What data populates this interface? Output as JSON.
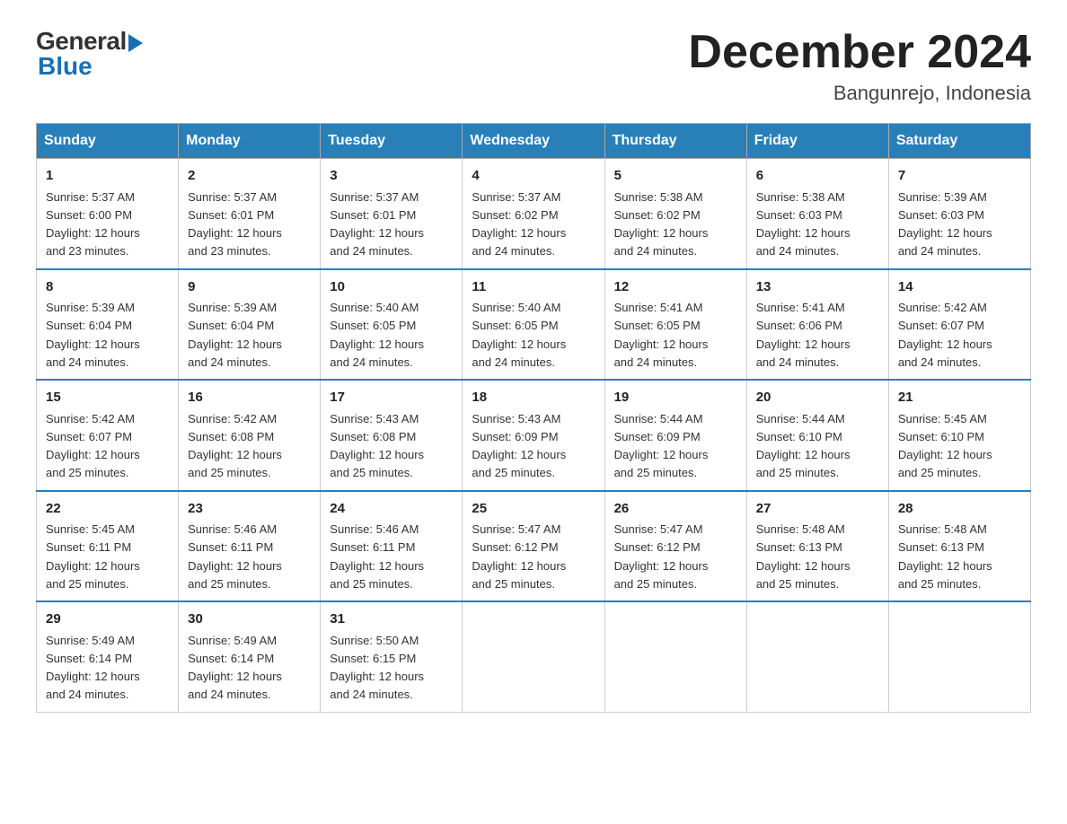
{
  "header": {
    "logo_general": "General",
    "logo_blue": "Blue",
    "month_title": "December 2024",
    "location": "Bangunrejo, Indonesia"
  },
  "days_of_week": [
    "Sunday",
    "Monday",
    "Tuesday",
    "Wednesday",
    "Thursday",
    "Friday",
    "Saturday"
  ],
  "weeks": [
    [
      {
        "day": "1",
        "sunrise": "5:37 AM",
        "sunset": "6:00 PM",
        "daylight": "12 hours and 23 minutes."
      },
      {
        "day": "2",
        "sunrise": "5:37 AM",
        "sunset": "6:01 PM",
        "daylight": "12 hours and 23 minutes."
      },
      {
        "day": "3",
        "sunrise": "5:37 AM",
        "sunset": "6:01 PM",
        "daylight": "12 hours and 24 minutes."
      },
      {
        "day": "4",
        "sunrise": "5:37 AM",
        "sunset": "6:02 PM",
        "daylight": "12 hours and 24 minutes."
      },
      {
        "day": "5",
        "sunrise": "5:38 AM",
        "sunset": "6:02 PM",
        "daylight": "12 hours and 24 minutes."
      },
      {
        "day": "6",
        "sunrise": "5:38 AM",
        "sunset": "6:03 PM",
        "daylight": "12 hours and 24 minutes."
      },
      {
        "day": "7",
        "sunrise": "5:39 AM",
        "sunset": "6:03 PM",
        "daylight": "12 hours and 24 minutes."
      }
    ],
    [
      {
        "day": "8",
        "sunrise": "5:39 AM",
        "sunset": "6:04 PM",
        "daylight": "12 hours and 24 minutes."
      },
      {
        "day": "9",
        "sunrise": "5:39 AM",
        "sunset": "6:04 PM",
        "daylight": "12 hours and 24 minutes."
      },
      {
        "day": "10",
        "sunrise": "5:40 AM",
        "sunset": "6:05 PM",
        "daylight": "12 hours and 24 minutes."
      },
      {
        "day": "11",
        "sunrise": "5:40 AM",
        "sunset": "6:05 PM",
        "daylight": "12 hours and 24 minutes."
      },
      {
        "day": "12",
        "sunrise": "5:41 AM",
        "sunset": "6:05 PM",
        "daylight": "12 hours and 24 minutes."
      },
      {
        "day": "13",
        "sunrise": "5:41 AM",
        "sunset": "6:06 PM",
        "daylight": "12 hours and 24 minutes."
      },
      {
        "day": "14",
        "sunrise": "5:42 AM",
        "sunset": "6:07 PM",
        "daylight": "12 hours and 24 minutes."
      }
    ],
    [
      {
        "day": "15",
        "sunrise": "5:42 AM",
        "sunset": "6:07 PM",
        "daylight": "12 hours and 25 minutes."
      },
      {
        "day": "16",
        "sunrise": "5:42 AM",
        "sunset": "6:08 PM",
        "daylight": "12 hours and 25 minutes."
      },
      {
        "day": "17",
        "sunrise": "5:43 AM",
        "sunset": "6:08 PM",
        "daylight": "12 hours and 25 minutes."
      },
      {
        "day": "18",
        "sunrise": "5:43 AM",
        "sunset": "6:09 PM",
        "daylight": "12 hours and 25 minutes."
      },
      {
        "day": "19",
        "sunrise": "5:44 AM",
        "sunset": "6:09 PM",
        "daylight": "12 hours and 25 minutes."
      },
      {
        "day": "20",
        "sunrise": "5:44 AM",
        "sunset": "6:10 PM",
        "daylight": "12 hours and 25 minutes."
      },
      {
        "day": "21",
        "sunrise": "5:45 AM",
        "sunset": "6:10 PM",
        "daylight": "12 hours and 25 minutes."
      }
    ],
    [
      {
        "day": "22",
        "sunrise": "5:45 AM",
        "sunset": "6:11 PM",
        "daylight": "12 hours and 25 minutes."
      },
      {
        "day": "23",
        "sunrise": "5:46 AM",
        "sunset": "6:11 PM",
        "daylight": "12 hours and 25 minutes."
      },
      {
        "day": "24",
        "sunrise": "5:46 AM",
        "sunset": "6:11 PM",
        "daylight": "12 hours and 25 minutes."
      },
      {
        "day": "25",
        "sunrise": "5:47 AM",
        "sunset": "6:12 PM",
        "daylight": "12 hours and 25 minutes."
      },
      {
        "day": "26",
        "sunrise": "5:47 AM",
        "sunset": "6:12 PM",
        "daylight": "12 hours and 25 minutes."
      },
      {
        "day": "27",
        "sunrise": "5:48 AM",
        "sunset": "6:13 PM",
        "daylight": "12 hours and 25 minutes."
      },
      {
        "day": "28",
        "sunrise": "5:48 AM",
        "sunset": "6:13 PM",
        "daylight": "12 hours and 25 minutes."
      }
    ],
    [
      {
        "day": "29",
        "sunrise": "5:49 AM",
        "sunset": "6:14 PM",
        "daylight": "12 hours and 24 minutes."
      },
      {
        "day": "30",
        "sunrise": "5:49 AM",
        "sunset": "6:14 PM",
        "daylight": "12 hours and 24 minutes."
      },
      {
        "day": "31",
        "sunrise": "5:50 AM",
        "sunset": "6:15 PM",
        "daylight": "12 hours and 24 minutes."
      },
      null,
      null,
      null,
      null
    ]
  ],
  "labels": {
    "sunrise": "Sunrise:",
    "sunset": "Sunset:",
    "daylight": "Daylight:"
  }
}
